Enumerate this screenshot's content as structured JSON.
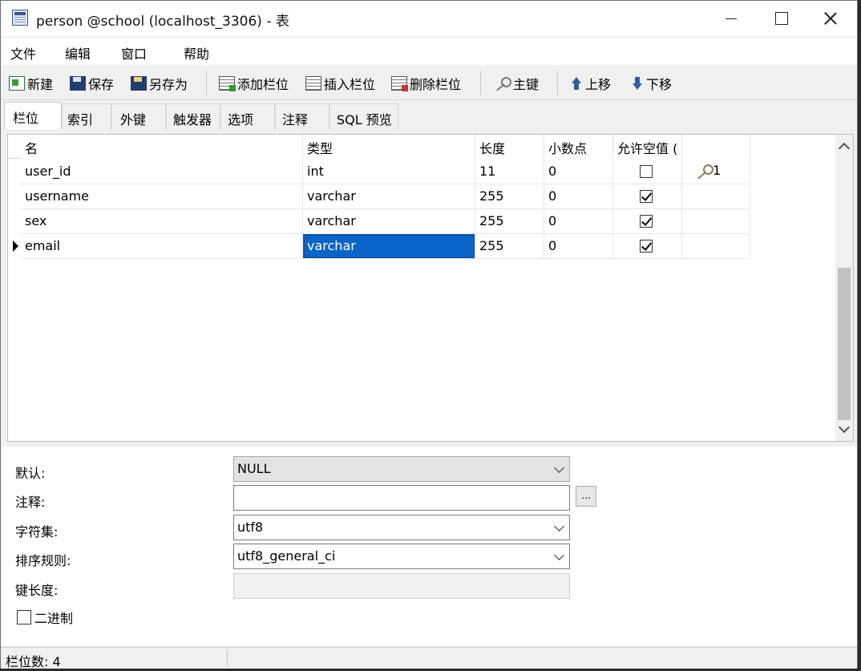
{
  "window": {
    "title": "person @school (localhost_3306) - 表"
  },
  "menu": {
    "items": [
      "文件",
      "编辑",
      "窗口",
      "帮助"
    ]
  },
  "toolbar": {
    "new": "新建",
    "save": "保存",
    "save_as": "另存为",
    "add_field": "添加栏位",
    "insert_field": "插入栏位",
    "delete_field": "删除栏位",
    "primary_key": "主键",
    "move_up": "上移",
    "move_down": "下移"
  },
  "tabs": [
    "栏位",
    "索引",
    "外键",
    "触发器",
    "选项",
    "注释",
    "SQL 预览"
  ],
  "grid": {
    "headers": [
      "名",
      "类型",
      "长度",
      "小数点",
      "允许空值 (",
      ""
    ],
    "rows": [
      {
        "name": "user_id",
        "type": "int",
        "length": "11",
        "decimals": "0",
        "nullable": false,
        "key": "1"
      },
      {
        "name": "username",
        "type": "varchar",
        "length": "255",
        "decimals": "0",
        "nullable": true,
        "key": ""
      },
      {
        "name": "sex",
        "type": "varchar",
        "length": "255",
        "decimals": "0",
        "nullable": true,
        "key": ""
      },
      {
        "name": "email",
        "type": "varchar",
        "length": "255",
        "decimals": "0",
        "nullable": true,
        "key": ""
      }
    ]
  },
  "properties": {
    "default_label": "默认:",
    "default_value": "NULL",
    "comment_label": "注释:",
    "comment_value": "",
    "comment_button": "...",
    "charset_label": "字符集:",
    "charset_value": "utf8",
    "collation_label": "排序规则:",
    "collation_value": "utf8_general_ci",
    "key_length_label": "键长度:",
    "key_length_value": "",
    "binary_label": "二进制"
  },
  "status": {
    "field_count": "栏位数: 4"
  }
}
